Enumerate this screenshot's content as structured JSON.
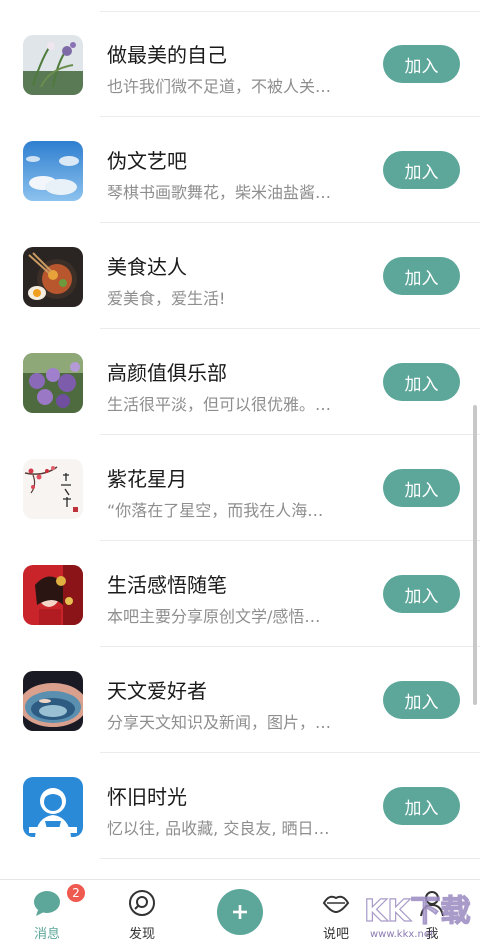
{
  "groups": [
    {
      "title": "做最美的自己",
      "desc": "也许我们微不足道，不被人关…",
      "button": "加入",
      "avatar_icon": "orchid-photo"
    },
    {
      "title": "伪文艺吧",
      "desc": "琴棋书画歌舞花，柴米油盐酱…",
      "button": "加入",
      "avatar_icon": "sky-clouds-photo"
    },
    {
      "title": "美食达人",
      "desc": "爱美食，爱生活!",
      "button": "加入",
      "avatar_icon": "food-bowl-photo"
    },
    {
      "title": "高颜值俱乐部",
      "desc": "生活很平淡，但可以很优雅。…",
      "button": "加入",
      "avatar_icon": "purple-flowers-photo"
    },
    {
      "title": "紫花星月",
      "desc": "“你落在了星空，而我在人海…",
      "button": "加入",
      "avatar_icon": "plum-blossom-calligraphy"
    },
    {
      "title": "生活感悟随笔",
      "desc": "本吧主要分享原创文学/感悟…",
      "button": "加入",
      "avatar_icon": "portrait-red-photo"
    },
    {
      "title": "天文爱好者",
      "desc": "分享天文知识及新闻，图片，…",
      "button": "加入",
      "avatar_icon": "planet-texture-photo"
    },
    {
      "title": "怀旧时光",
      "desc": "忆以往, 品收藏, 交良友, 晒日…",
      "button": "加入",
      "avatar_icon": "vintage-poster-photo"
    }
  ],
  "tabbar": {
    "messages": {
      "label": "消息",
      "badge": "2",
      "icon": "message-bubble-icon"
    },
    "discover": {
      "label": "发现",
      "icon": "compass-icon"
    },
    "post": {
      "icon": "plus-icon"
    },
    "talk": {
      "label": "说吧",
      "icon": "lips-icon"
    },
    "me": {
      "label": "我",
      "icon": "person-icon"
    }
  },
  "watermark": {
    "text": "www.kkx.net",
    "logo": "KK下载"
  },
  "colors": {
    "accent": "#5ca69a",
    "badge": "#ef5a50"
  }
}
